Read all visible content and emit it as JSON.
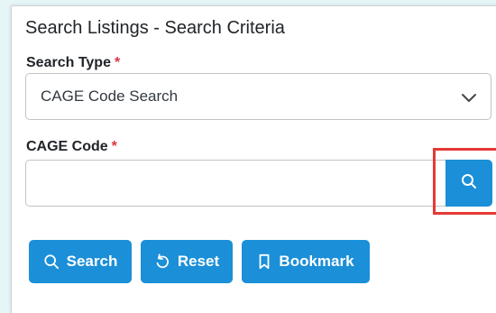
{
  "panel": {
    "title": "Search Listings - Search Criteria"
  },
  "search_type": {
    "label": "Search Type",
    "required_mark": "*",
    "selected_value": "CAGE Code Search",
    "chevron_icon": "chevron-down-icon"
  },
  "cage_code": {
    "label": "CAGE Code",
    "required_mark": "*",
    "value": "",
    "lookup_icon": "search-icon"
  },
  "actions": {
    "search_label": "Search",
    "search_icon": "search-icon",
    "reset_label": "Reset",
    "reset_icon": "reset-icon",
    "bookmark_label": "Bookmark",
    "bookmark_icon": "bookmark-icon"
  },
  "colors": {
    "primary": "#1b8fd8",
    "required": "#dc3545",
    "highlight": "#e53935",
    "page_background": "#e6f6f8"
  }
}
